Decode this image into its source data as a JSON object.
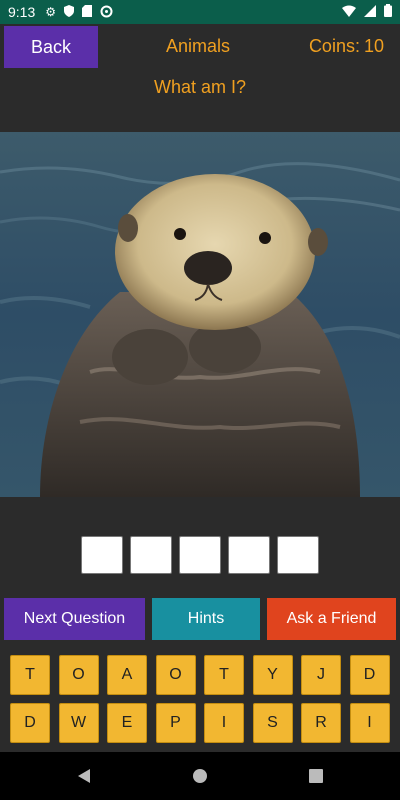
{
  "status_bar": {
    "time": "9:13",
    "icons": [
      "settings-icon",
      "shield-icon",
      "sd-card-icon",
      "data-saver-icon",
      "wifi-icon",
      "signal-icon",
      "battery-icon"
    ]
  },
  "header": {
    "back_label": "Back",
    "category": "Animals",
    "coins_label": "Coins:",
    "coins_value": "10",
    "question": "What am I?"
  },
  "picture": {
    "subject": "sea-otter-image"
  },
  "answer": {
    "slots": [
      "",
      "",
      "",
      "",
      ""
    ]
  },
  "actions": {
    "next_label": "Next Question",
    "hints_label": "Hints",
    "friend_label": "Ask a Friend"
  },
  "letters": {
    "row1": [
      "T",
      "O",
      "A",
      "O",
      "T",
      "Y",
      "J",
      "D"
    ],
    "row2": [
      "D",
      "W",
      "E",
      "P",
      "I",
      "S",
      "R",
      "I"
    ]
  },
  "colors": {
    "accent_text": "#f0a020",
    "purple_button": "#5b2fa9",
    "teal_button": "#1890a0",
    "orange_button": "#e0441e",
    "letter_key": "#f2b731",
    "status_bar": "#0b5e4b"
  }
}
